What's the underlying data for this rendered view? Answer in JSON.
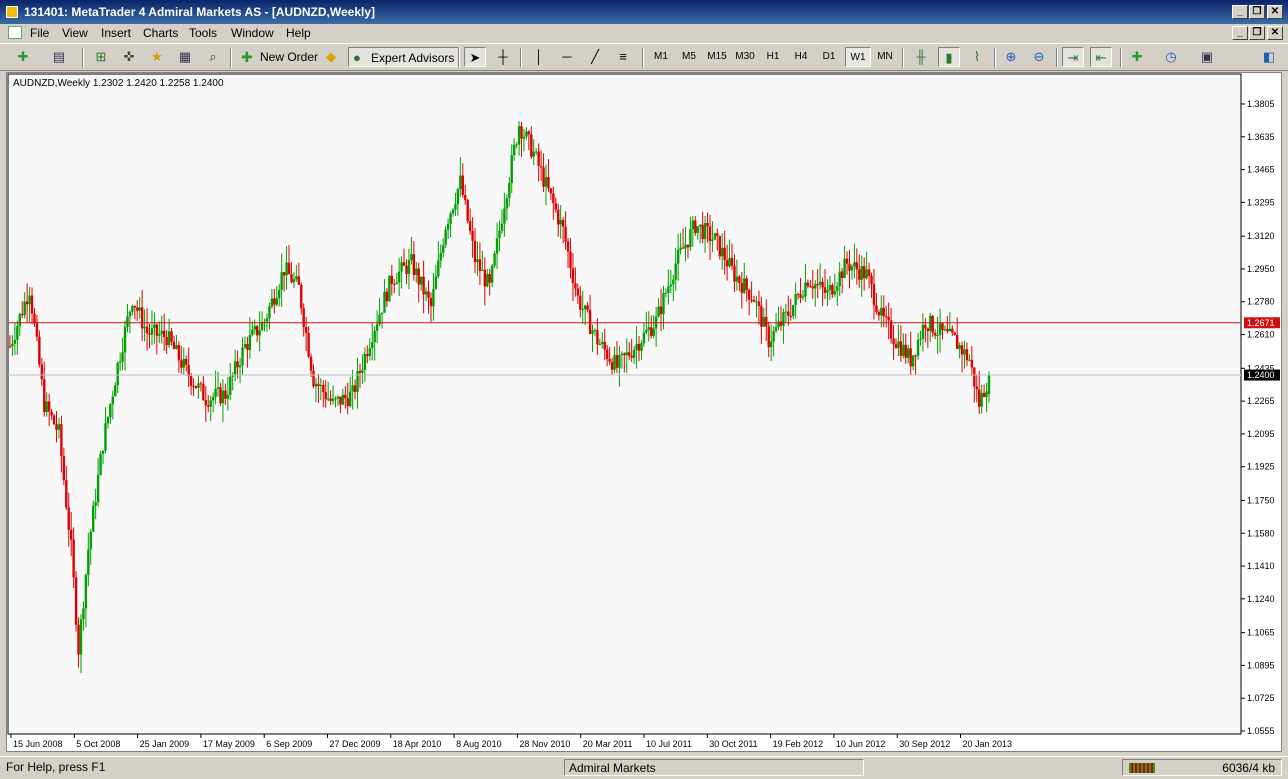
{
  "window": {
    "title": "131401: MetaTrader 4 Admiral Markets AS - [AUDNZD,Weekly]"
  },
  "menu": [
    "File",
    "View",
    "Insert",
    "Charts",
    "Tools",
    "Window",
    "Help"
  ],
  "toolbar": {
    "new_order_label": "New Order",
    "expert_advisors_label": "Expert Advisors",
    "timeframes": [
      "M1",
      "M5",
      "M15",
      "M30",
      "H1",
      "H4",
      "D1",
      "W1",
      "MN"
    ],
    "active_timeframe": "W1"
  },
  "chart": {
    "info": "AUDNZD,Weekly  1.2302 1.2420 1.2258 1.2400",
    "price_labels": [
      "1.3805",
      "1.3635",
      "1.3465",
      "1.3295",
      "1.3120",
      "1.2950",
      "1.2780",
      "1.2610",
      "1.2435",
      "1.2265",
      "1.2095",
      "1.1925",
      "1.1750",
      "1.1580",
      "1.1410",
      "1.1240",
      "1.1065",
      "1.0895",
      "1.0725",
      "1.0555"
    ],
    "date_labels": [
      "15 Jun 2008",
      "5 Oct 2008",
      "25 Jan 2009",
      "17 May 2009",
      "6 Sep 2009",
      "27 Dec 2009",
      "18 Apr 2010",
      "8 Aug 2010",
      "28 Nov 2010",
      "20 Mar 2011",
      "10 Jul 2011",
      "30 Oct 2011",
      "19 Feb 2012",
      "10 Jun 2012",
      "30 Sep 2012",
      "20 Jan 2013"
    ],
    "level_line": "1.2671",
    "bid_line": "1.2400",
    "colors": {
      "bull": "#00a000",
      "bear": "#e00000",
      "level": "#d01010",
      "bid": "#c0c0c0"
    }
  },
  "status": {
    "help": "For Help, press F1",
    "profile": "Admiral Markets",
    "traffic": "6036/4 kb"
  }
}
